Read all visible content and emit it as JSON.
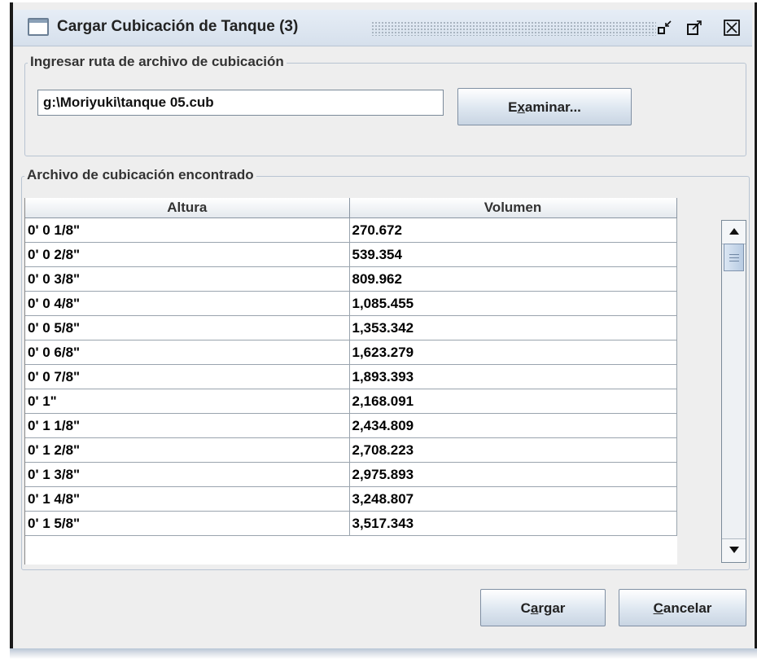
{
  "window": {
    "title": "Cargar Cubicación de Tanque (3)",
    "controls": [
      "minimize-icon",
      "maximize-icon",
      "close-icon"
    ]
  },
  "path_group": {
    "title": "Ingresar ruta de archivo de cubicación",
    "path_value": "g:\\Moriyuki\\tanque 05.cub",
    "browse_label_pre": "E",
    "browse_label_mnemonic": "x",
    "browse_label_post": "aminar..."
  },
  "table_group": {
    "title": "Archivo de cubicación encontrado",
    "columns": [
      "Altura",
      "Volumen"
    ],
    "rows": [
      [
        "0' 0 1/8\"",
        "270.672"
      ],
      [
        "0' 0 2/8\"",
        "539.354"
      ],
      [
        "0' 0 3/8\"",
        "809.962"
      ],
      [
        "0' 0 4/8\"",
        "1,085.455"
      ],
      [
        "0' 0 5/8\"",
        "1,353.342"
      ],
      [
        "0' 0 6/8\"",
        "1,623.279"
      ],
      [
        "0' 0 7/8\"",
        "1,893.393"
      ],
      [
        "0' 1\"",
        "2,168.091"
      ],
      [
        "0' 1 1/8\"",
        "2,434.809"
      ],
      [
        "0' 1 2/8\"",
        "2,708.223"
      ],
      [
        "0' 1 3/8\"",
        "2,975.893"
      ],
      [
        "0' 1 4/8\"",
        "3,248.807"
      ],
      [
        "0' 1 5/8\"",
        "3,517.343"
      ]
    ]
  },
  "actions": {
    "load_pre": "C",
    "load_mnemonic": "a",
    "load_post": "rgar",
    "cancel_mnemonic": "C",
    "cancel_post": "ancelar"
  }
}
